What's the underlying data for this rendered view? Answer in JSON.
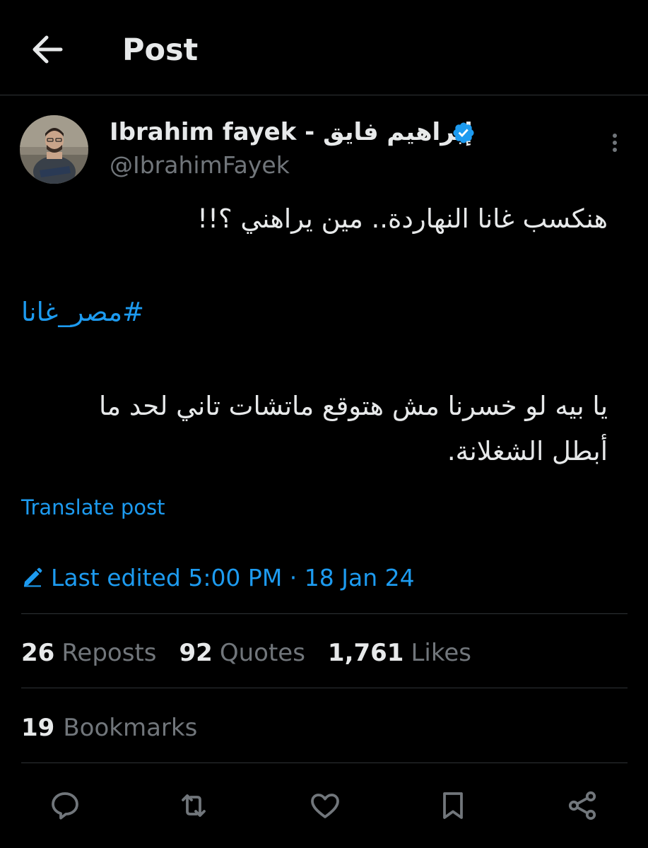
{
  "header": {
    "title": "Post",
    "back_icon": "arrow-left-icon"
  },
  "author": {
    "name": "Ibrahim fayek - إبراهيم فايق",
    "handle": "@IbrahimFayek",
    "verified": true
  },
  "post": {
    "line1": "هنكسب غانا النهاردة.. مين يراهني ؟!!",
    "hashtag": "#مصر_غانا",
    "line2": "يا بيه لو خسرنا مش هتوقع ماتشات تاني لحد ما",
    "line3": "أبطل الشغلانة."
  },
  "translate_label": "Translate post",
  "edited": {
    "label": "Last edited 5:00 PM · 18 Jan 24",
    "icon": "pencil-icon"
  },
  "stats": {
    "reposts_count": "26",
    "reposts_label": "Reposts",
    "quotes_count": "92",
    "quotes_label": "Quotes",
    "likes_count": "1,761",
    "likes_label": "Likes",
    "bookmarks_count": "19",
    "bookmarks_label": "Bookmarks"
  },
  "actions": [
    "reply-icon",
    "repost-icon",
    "like-icon",
    "bookmark-icon",
    "share-icon"
  ],
  "colors": {
    "background": "#000000",
    "text": "#e7e9ea",
    "secondary": "#71767b",
    "accent": "#1d9bf0",
    "divider": "#2f3336"
  }
}
